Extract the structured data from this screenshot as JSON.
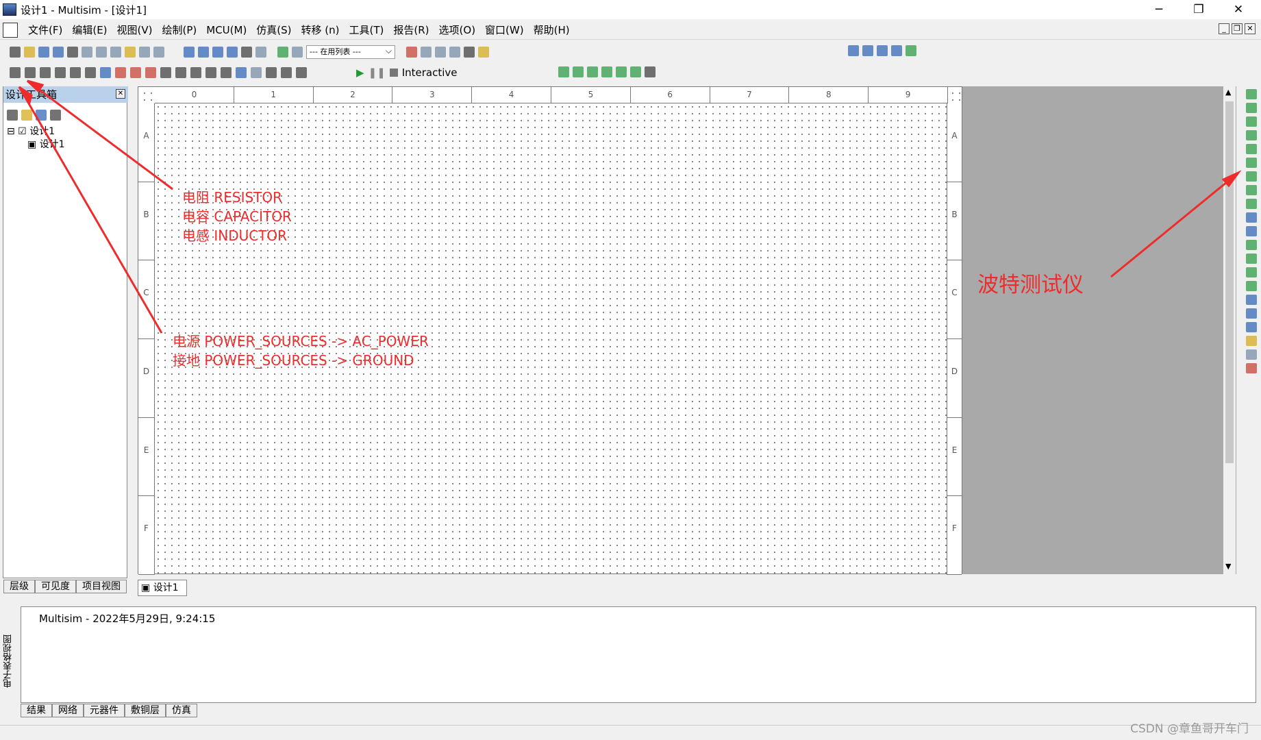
{
  "window": {
    "title": "设计1 - Multisim - [设计1]",
    "minimize": "─",
    "restore": "❐",
    "close": "✕"
  },
  "menu": [
    "文件(F)",
    "编辑(E)",
    "视图(V)",
    "绘制(P)",
    "MCU(M)",
    "仿真(S)",
    "转移 (n)",
    "工具(T)",
    "报告(R)",
    "选项(O)",
    "窗口(W)",
    "帮助(H)"
  ],
  "toolbar1": {
    "icons": [
      "new-file-icon",
      "open-icon",
      "open-sample-icon",
      "save-icon",
      "print-icon",
      "print-preview-icon",
      "cut-icon",
      "copy-icon",
      "paste-icon",
      "undo-icon",
      "redo-icon",
      "grapher-icon",
      "spreadsheet-icon",
      "show-grid-icon",
      "ruler-icon",
      "description-icon",
      "parts-list-icon",
      "component-wizard-icon",
      "database-icon"
    ],
    "in_use_list": "--- 在用列表 ---",
    "icons_right": [
      "erc-icon",
      "back-annotate-icon",
      "forward-annotate-icon",
      "transfer-icon",
      "search-icon",
      "help-icon"
    ],
    "zoom_icons": [
      "zoom-in-icon",
      "zoom-out-icon",
      "zoom-area-icon",
      "zoom-fit-icon",
      "full-screen-icon"
    ]
  },
  "toolbar2": {
    "component_icons": [
      "source-icon",
      "basic-component-icon",
      "diode-icon",
      "transistor-icon",
      "analog-icon",
      "ttl-icon",
      "cmos-icon",
      "mcu-icon",
      "advanced-peripherals-icon",
      "misc-digital-icon",
      "mixed-icon",
      "indicator-icon",
      "power-component-icon",
      "misc-icon",
      "rf-icon",
      "electromech-icon",
      "ni-component-icon",
      "connector-icon",
      "hierarchical-block-icon",
      "bus-icon"
    ],
    "sim_mode": "Interactive",
    "probe_icons": [
      "voltage-probe-icon",
      "current-probe-icon",
      "power-probe-icon",
      "differential-probe-icon",
      "voltage-reference-probe-icon",
      "digital-probe-icon",
      "probe-settings-icon"
    ]
  },
  "toolbox": {
    "title": "设计工具箱",
    "close": "✕",
    "pin": "-",
    "tree": {
      "root": "设计1",
      "child": "设计1"
    },
    "tabs": [
      "层级",
      "可见度",
      "项目视图"
    ]
  },
  "sheet": {
    "cols": [
      "0",
      "1",
      "2",
      "3",
      "4",
      "5",
      "6",
      "7",
      "8",
      "9"
    ],
    "rows": [
      "A",
      "B",
      "C",
      "D",
      "E",
      "F"
    ],
    "tab": "设计1"
  },
  "console": {
    "line": "Multisim  -  2022年5月29日, 9:24:15",
    "side_label": "电子表格视图",
    "tabs": [
      "结果",
      "网络",
      "元器件",
      "敷铜层",
      "仿真"
    ]
  },
  "annotations": {
    "components": "电阻 RESISTOR\n电容 CAPACITOR\n电感 INDUCTOR",
    "power": "电源 POWER_SOURCES -> AC_POWER\n接地 POWER_SOURCES -> GROUND",
    "bode": "波特测试仪",
    "color": "#ee2c2c"
  },
  "watermark": "CSDN @章鱼哥开车门"
}
